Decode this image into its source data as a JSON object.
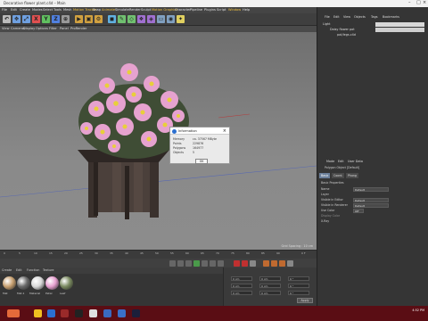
{
  "window": {
    "title": "Decorative flower plant.c4d – Main"
  },
  "menubar": {
    "items": [
      "File",
      "Edit",
      "Create",
      "Modes",
      "Select",
      "Tools",
      "Mesh",
      "Motion Tracker",
      "Snap",
      "Animate",
      "Simulate",
      "Render",
      "Sculpt",
      "Motion Graphics",
      "Character",
      "Pipeline",
      "Plugins",
      "Script",
      "Window",
      "Help"
    ]
  },
  "viewport": {
    "menu": [
      "View",
      "Cameras",
      "Display",
      "Options",
      "Filter",
      "Panel",
      "ProRender"
    ],
    "footer": "Grid Spacing : 10 cm"
  },
  "dialog": {
    "title": "Information",
    "rows": [
      {
        "label": "Memory",
        "value": "ca. 37567 MByte"
      },
      {
        "label": "Points",
        "value": "229876"
      },
      {
        "label": "Polygons",
        "value": "164977"
      },
      {
        "label": "Objects",
        "value": "5"
      }
    ],
    "ok": "OK"
  },
  "timeline": {
    "ticks": [
      "0",
      "5",
      "10",
      "15",
      "20",
      "25",
      "30",
      "35",
      "40",
      "45",
      "50",
      "55",
      "60",
      "65",
      "70",
      "75",
      "80",
      "85",
      "90"
    ],
    "frame": "0 F"
  },
  "materials": {
    "menu": [
      "Create",
      "Edit",
      "Function",
      "Texture"
    ],
    "items": [
      {
        "name": "Mat",
        "color": "#c8a070"
      },
      {
        "name": "Mat.1",
        "color": "#6a6a6a"
      },
      {
        "name": "Material",
        "color": "#d9d9d9"
      },
      {
        "name": "Petal",
        "color": "#e7a0d0"
      },
      {
        "name": "Leaf",
        "color": "#7a8a60"
      }
    ]
  },
  "coords": {
    "apply": "Apply"
  },
  "objects_panel": {
    "menu": [
      "File",
      "Edit",
      "View",
      "Objects",
      "Tags",
      "Bookmarks"
    ],
    "rows": [
      "Light",
      "Daisy flower pot",
      "pot/legs.c4d"
    ]
  },
  "attributes": {
    "menu": [
      "Mode",
      "Edit",
      "User Data"
    ],
    "header": "Polygon Object [Default]",
    "tabs": [
      "Basic",
      "Coord.",
      "Phong"
    ],
    "section": "Basic Properties",
    "rows": [
      {
        "label": "Name",
        "value": "Default"
      },
      {
        "label": "Layer",
        "value": ""
      },
      {
        "label": "Visible in Editor",
        "value": "Default"
      },
      {
        "label": "Visible in Renderer",
        "value": "Default"
      },
      {
        "label": "Use Color",
        "value": "Off"
      },
      {
        "label": "Display Color",
        "value": ""
      },
      {
        "label": "X-Ray",
        "value": ""
      }
    ]
  },
  "taskbar": {
    "time": "4:52 PM"
  }
}
